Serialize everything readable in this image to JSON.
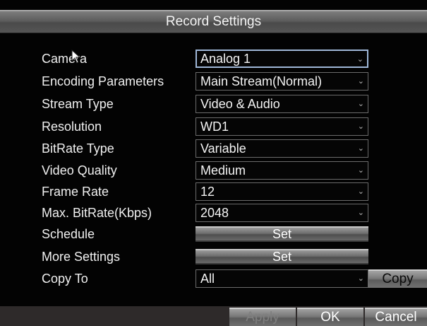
{
  "dialog": {
    "title": "Record Settings"
  },
  "fields": [
    {
      "label": "Camera",
      "value": "Analog 1"
    },
    {
      "label": "Encoding Parameters",
      "value": "Main Stream(Normal)"
    },
    {
      "label": "Stream Type",
      "value": "Video & Audio"
    },
    {
      "label": "Resolution",
      "value": "WD1"
    },
    {
      "label": "BitRate Type",
      "value": "Variable"
    },
    {
      "label": "Video Quality",
      "value": "Medium"
    },
    {
      "label": "Frame Rate",
      "value": "12"
    },
    {
      "label": "Max. BitRate(Kbps)",
      "value": "2048"
    }
  ],
  "schedule": {
    "label": "Schedule",
    "button": "Set"
  },
  "more_settings": {
    "label": "More Settings",
    "button": "Set"
  },
  "copy_to": {
    "label": "Copy To",
    "value": "All",
    "button": "Copy"
  },
  "footer": {
    "apply": "Apply",
    "ok": "OK",
    "cancel": "Cancel"
  },
  "icons": {
    "dropdown": "chevron-down-icon",
    "pointer": "mouse-pointer-icon"
  }
}
